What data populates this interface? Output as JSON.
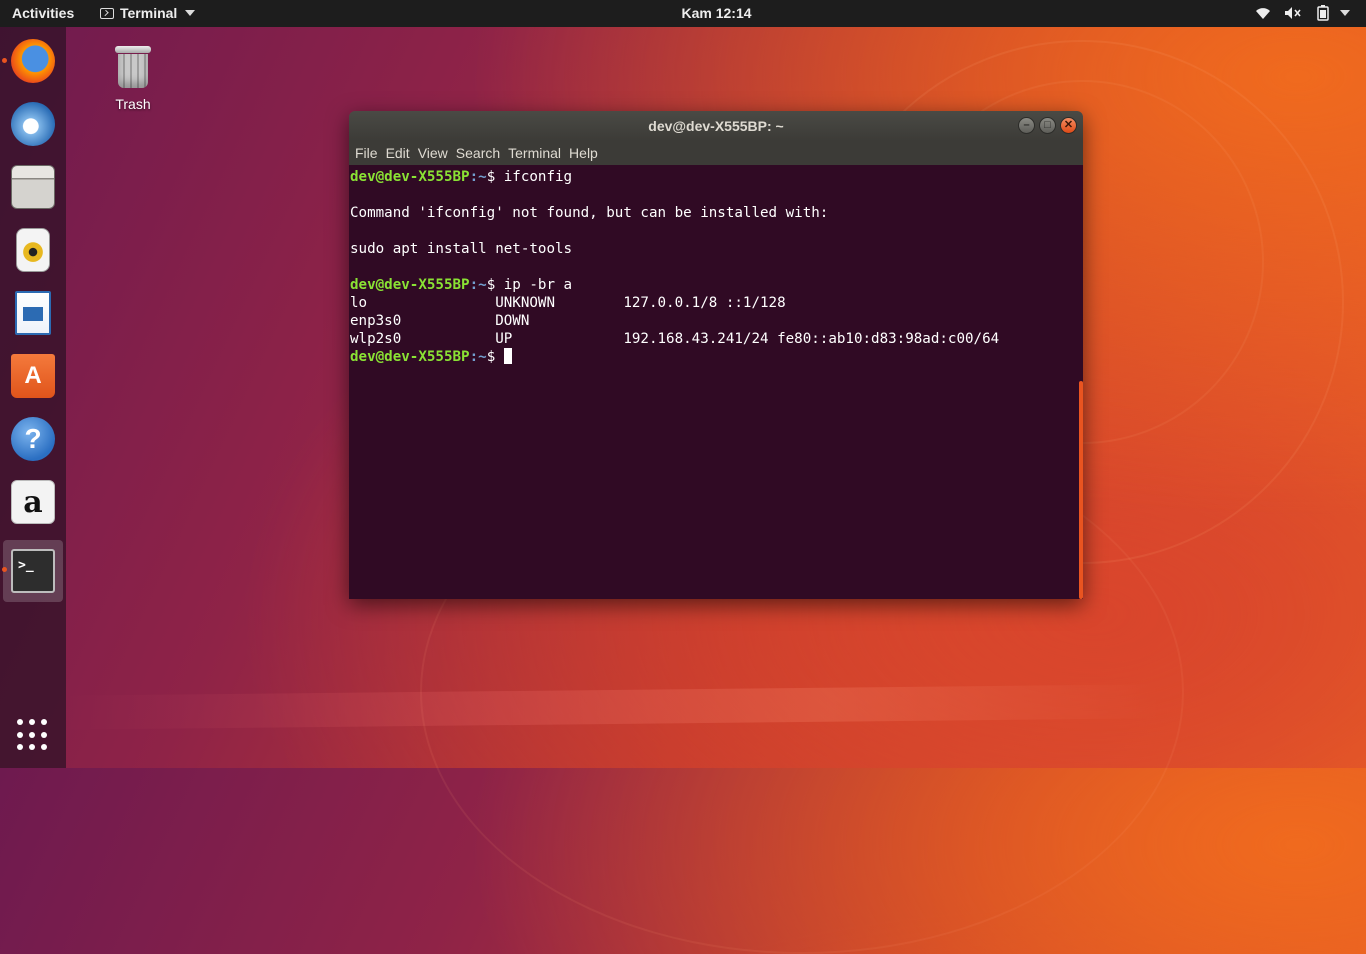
{
  "topbar": {
    "activities": "Activities",
    "app_menu_label": "Terminal",
    "clock": "Kam 12:14"
  },
  "dock": {
    "items": [
      {
        "name": "firefox",
        "running": true
      },
      {
        "name": "thunderbird",
        "running": false
      },
      {
        "name": "files",
        "running": false
      },
      {
        "name": "rhythmbox",
        "running": false
      },
      {
        "name": "libreoffice-writer",
        "running": false
      },
      {
        "name": "ubuntu-software",
        "running": false
      },
      {
        "name": "help",
        "running": false
      },
      {
        "name": "amazon",
        "running": false
      },
      {
        "name": "terminal",
        "running": true
      }
    ]
  },
  "desktop": {
    "trash_label": "Trash"
  },
  "window": {
    "title": "dev@dev-X555BP: ~",
    "menu": [
      "File",
      "Edit",
      "View",
      "Search",
      "Terminal",
      "Help"
    ],
    "prompt_user": "dev@dev-X555BP",
    "prompt_path": ":~",
    "lines": [
      {
        "type": "prompt",
        "command": "ifconfig"
      },
      {
        "type": "text",
        "text": ""
      },
      {
        "type": "text",
        "text": "Command 'ifconfig' not found, but can be installed with:"
      },
      {
        "type": "text",
        "text": ""
      },
      {
        "type": "text",
        "text": "sudo apt install net-tools"
      },
      {
        "type": "text",
        "text": ""
      },
      {
        "type": "prompt",
        "command": "ip -br a"
      },
      {
        "type": "text",
        "text": "lo               UNKNOWN        127.0.0.1/8 ::1/128"
      },
      {
        "type": "text",
        "text": "enp3s0           DOWN"
      },
      {
        "type": "text",
        "text": "wlp2s0           UP             192.168.43.241/24 fe80::ab10:d83:98ad:c00/64"
      },
      {
        "type": "prompt",
        "command": "",
        "cursor": true
      }
    ]
  },
  "colors": {
    "accent": "#e95420",
    "terminal_bg": "#300a24",
    "prompt_user": "#8ae234",
    "prompt_path": "#729fcf"
  }
}
